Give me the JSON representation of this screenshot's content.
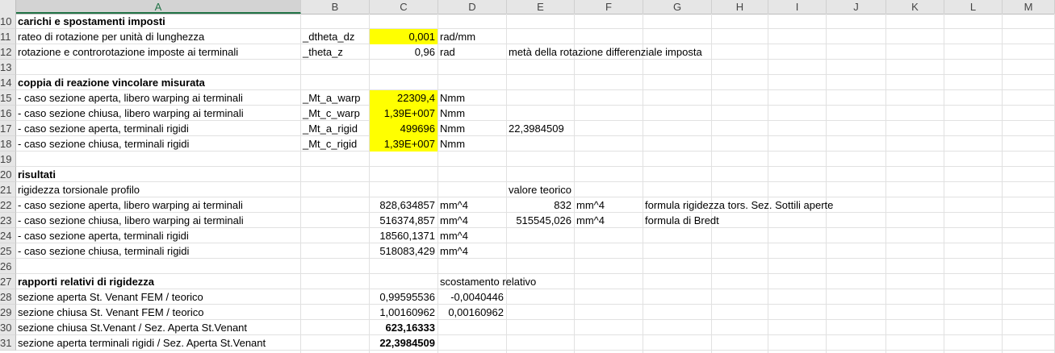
{
  "columns": [
    "A",
    "B",
    "C",
    "D",
    "E",
    "F",
    "G",
    "H",
    "I",
    "J",
    "K",
    "L",
    "M"
  ],
  "rows": [
    {
      "num": "10",
      "cells": [
        {
          "col": "A",
          "text": "carichi e spostamenti imposti",
          "bold": true
        }
      ]
    },
    {
      "num": "11",
      "cells": [
        {
          "col": "A",
          "text": "rateo di rotazione per unità di lunghezza"
        },
        {
          "col": "B",
          "text": "_dtheta_dz"
        },
        {
          "col": "C",
          "text": "0,001",
          "align": "r",
          "fill": "yellow"
        },
        {
          "col": "D",
          "text": "rad/mm"
        }
      ]
    },
    {
      "num": "12",
      "cells": [
        {
          "col": "A",
          "text": "rotazione e controrotazione imposte ai terminali"
        },
        {
          "col": "B",
          "text": "_theta_z"
        },
        {
          "col": "C",
          "text": "0,96",
          "align": "r"
        },
        {
          "col": "D",
          "text": "rad"
        },
        {
          "col": "E",
          "text": "metà della rotazione differenziale imposta"
        }
      ]
    },
    {
      "num": "13",
      "cells": []
    },
    {
      "num": "14",
      "cells": [
        {
          "col": "A",
          "text": "coppia di reazione vincolare misurata",
          "bold": true
        }
      ]
    },
    {
      "num": "15",
      "cells": [
        {
          "col": "A",
          "text": "- caso sezione aperta, libero warping ai terminali"
        },
        {
          "col": "B",
          "text": "_Mt_a_warp"
        },
        {
          "col": "C",
          "text": "22309,4",
          "align": "r",
          "fill": "yellow"
        },
        {
          "col": "D",
          "text": "Nmm"
        }
      ]
    },
    {
      "num": "16",
      "cells": [
        {
          "col": "A",
          "text": "- caso sezione chiusa, libero warping ai terminali"
        },
        {
          "col": "B",
          "text": "_Mt_c_warp"
        },
        {
          "col": "C",
          "text": "1,39E+007",
          "align": "r",
          "fill": "yellow"
        },
        {
          "col": "D",
          "text": "Nmm"
        }
      ]
    },
    {
      "num": "17",
      "cells": [
        {
          "col": "A",
          "text": "- caso sezione aperta, terminali rigidi"
        },
        {
          "col": "B",
          "text": "_Mt_a_rigid"
        },
        {
          "col": "C",
          "text": "499696",
          "align": "r",
          "fill": "yellow"
        },
        {
          "col": "D",
          "text": "Nmm"
        },
        {
          "col": "E",
          "text": "22,3984509"
        }
      ]
    },
    {
      "num": "18",
      "cells": [
        {
          "col": "A",
          "text": "- caso sezione chiusa, terminali rigidi"
        },
        {
          "col": "B",
          "text": "_Mt_c_rigid"
        },
        {
          "col": "C",
          "text": "1,39E+007",
          "align": "r",
          "fill": "yellow"
        },
        {
          "col": "D",
          "text": "Nmm"
        }
      ]
    },
    {
      "num": "19",
      "cells": []
    },
    {
      "num": "20",
      "cells": [
        {
          "col": "A",
          "text": "risultati",
          "bold": true
        }
      ]
    },
    {
      "num": "21",
      "cells": [
        {
          "col": "A",
          "text": "rigidezza torsionale profilo"
        },
        {
          "col": "E",
          "text": "valore teorico"
        }
      ]
    },
    {
      "num": "22",
      "cells": [
        {
          "col": "A",
          "text": "- caso sezione aperta, libero warping ai terminali"
        },
        {
          "col": "C",
          "text": "828,634857",
          "align": "r"
        },
        {
          "col": "D",
          "text": "mm^4"
        },
        {
          "col": "E",
          "text": "832",
          "align": "r"
        },
        {
          "col": "F",
          "text": "mm^4"
        },
        {
          "col": "G",
          "text": "formula rigidezza tors. Sez. Sottili aperte"
        }
      ]
    },
    {
      "num": "23",
      "cells": [
        {
          "col": "A",
          "text": "- caso sezione chiusa, libero warping ai terminali"
        },
        {
          "col": "C",
          "text": "516374,857",
          "align": "r"
        },
        {
          "col": "D",
          "text": "mm^4"
        },
        {
          "col": "E",
          "text": "515545,026",
          "align": "r"
        },
        {
          "col": "F",
          "text": "mm^4"
        },
        {
          "col": "G",
          "text": "formula di Bredt"
        }
      ]
    },
    {
      "num": "24",
      "cells": [
        {
          "col": "A",
          "text": "- caso sezione aperta, terminali rigidi"
        },
        {
          "col": "C",
          "text": "18560,1371",
          "align": "r"
        },
        {
          "col": "D",
          "text": "mm^4"
        }
      ]
    },
    {
      "num": "25",
      "cells": [
        {
          "col": "A",
          "text": "- caso sezione chiusa, terminali rigidi"
        },
        {
          "col": "C",
          "text": "518083,429",
          "align": "r"
        },
        {
          "col": "D",
          "text": "mm^4"
        }
      ]
    },
    {
      "num": "26",
      "cells": []
    },
    {
      "num": "27",
      "cells": [
        {
          "col": "A",
          "text": "rapporti relativi di rigidezza",
          "bold": true
        },
        {
          "col": "D",
          "text": "scostamento relativo"
        }
      ]
    },
    {
      "num": "28",
      "cells": [
        {
          "col": "A",
          "text": "sezione aperta St. Venant  FEM / teorico"
        },
        {
          "col": "C",
          "text": "0,99595536",
          "align": "r"
        },
        {
          "col": "D",
          "text": "-0,0040446",
          "align": "r"
        }
      ]
    },
    {
      "num": "29",
      "cells": [
        {
          "col": "A",
          "text": "sezione chiusa St. Venant  FEM / teorico"
        },
        {
          "col": "C",
          "text": "1,00160962",
          "align": "r"
        },
        {
          "col": "D",
          "text": "0,00160962",
          "align": "r"
        }
      ]
    },
    {
      "num": "30",
      "cells": [
        {
          "col": "A",
          "text": "sezione chiusa St.Venant / Sez. Aperta St.Venant"
        },
        {
          "col": "C",
          "text": "623,16333",
          "align": "r",
          "bold": true
        }
      ]
    },
    {
      "num": "31",
      "cells": [
        {
          "col": "A",
          "text": "sezione aperta terminali rigidi / Sez. Aperta St.Venant"
        },
        {
          "col": "C",
          "text": "22,3984509",
          "align": "r",
          "bold": true
        }
      ]
    }
  ],
  "colors": {
    "highlight": "#ffff00",
    "header_bg": "#e6e6e6",
    "selected_header": "#217346",
    "gridline": "#e1e1e1"
  }
}
